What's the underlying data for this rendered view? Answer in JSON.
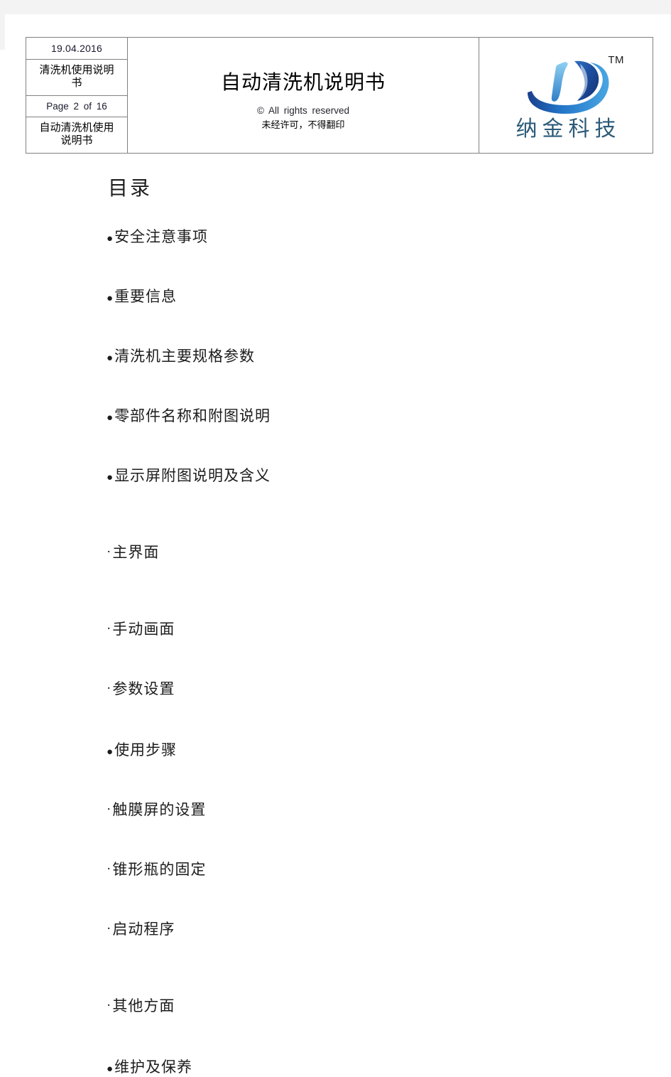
{
  "header": {
    "date": "19.04.2016",
    "doc_label_cn": "清洗机使用说明书",
    "page_indicator": "Page 2 of 16",
    "manual_label_cn": "自动清洗机使用说明书",
    "title": "自动清洗机说明书",
    "copyright_en": "© All rights reserved",
    "copyright_cn": "未经许可，不得翻印",
    "logo_tm": "TM",
    "logo_name": "纳金科技",
    "logo_colors": {
      "mark_dark": "#1d3f8f",
      "mark_mid": "#1f6fc4",
      "mark_light": "#5fb3e8",
      "name_text": "#2b5a78"
    }
  },
  "toc": {
    "heading": "目录",
    "items": [
      {
        "marker": "●",
        "level": 1,
        "label": "安全注意事项"
      },
      {
        "marker": "●",
        "level": 1,
        "label": "重要信息"
      },
      {
        "marker": "●",
        "level": 1,
        "label": "清洗机主要规格参数"
      },
      {
        "marker": "●",
        "level": 1,
        "label": "零部件名称和附图说明"
      },
      {
        "marker": "●",
        "level": 1,
        "label": "显示屏附图说明及含义"
      },
      {
        "marker": "·",
        "level": 2,
        "label": "主界面"
      },
      {
        "marker": "·",
        "level": 2,
        "label": "手动画面"
      },
      {
        "marker": "·",
        "level": 2,
        "label": "参数设置"
      },
      {
        "marker": "●",
        "level": 1,
        "label": "使用步骤"
      },
      {
        "marker": "·",
        "level": 2,
        "label": "触膜屏的设置"
      },
      {
        "marker": "·",
        "level": 2,
        "label": "锥形瓶的固定"
      },
      {
        "marker": "·",
        "level": 2,
        "label": "启动程序"
      },
      {
        "marker": "·",
        "level": 2,
        "label": "其他方面"
      },
      {
        "marker": "●",
        "level": 1,
        "label": "维护及保养"
      }
    ]
  }
}
